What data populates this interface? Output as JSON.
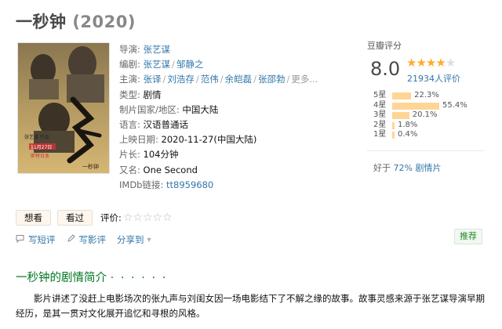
{
  "title": {
    "name": "一秒钟",
    "year": "(2020)"
  },
  "poster": {
    "release_line1": "11月27日",
    "release_line2": "即将日本",
    "calligraphy": "一秒钟",
    "director_caption": "张艺谋 作品"
  },
  "info": {
    "director_label": "导演:",
    "director": "张艺谋",
    "writer_label": "编剧:",
    "writers": [
      "张艺谋",
      "邹静之"
    ],
    "cast_label": "主演:",
    "cast": [
      "张译",
      "刘浩存",
      "范伟",
      "余皑磊",
      "张邵勃"
    ],
    "cast_more": "更多...",
    "genre_label": "类型:",
    "genre": "剧情",
    "region_label": "制片国家/地区:",
    "region": "中国大陆",
    "language_label": "语言:",
    "language": "汉语普通话",
    "release_label": "上映日期:",
    "release": "2020-11-27(中国大陆)",
    "runtime_label": "片长:",
    "runtime": "104分钟",
    "aka_label": "又名:",
    "aka": "One Second",
    "imdb_label": "IMDb链接:",
    "imdb": "tt8959680"
  },
  "rating": {
    "label": "豆瓣评分",
    "score": "8.0",
    "stars_filled": 4,
    "votes": "21934人评价",
    "distribution": [
      {
        "label": "5星",
        "pct": "22.3%",
        "value": 22.3
      },
      {
        "label": "4星",
        "pct": "55.4%",
        "value": 55.4
      },
      {
        "label": "3星",
        "pct": "20.1%",
        "value": 20.1
      },
      {
        "label": "2星",
        "pct": "1.8%",
        "value": 1.8
      },
      {
        "label": "1星",
        "pct": "0.4%",
        "value": 0.4
      }
    ],
    "better_prefix": "好于",
    "better_pct": "72%",
    "better_genre": "剧情片"
  },
  "actions": {
    "want": "想看",
    "seen": "看过",
    "rate_label": "评价:",
    "rate_stars": "☆☆☆☆☆",
    "write_short": "写短评",
    "write_review": "写影评",
    "share": "分享到",
    "share_arrow": "▾",
    "recommend": "推荐"
  },
  "summary": {
    "heading": "一秒钟的剧情简介",
    "heading_dots": "· · · · · ·",
    "text": "影片讲述了没赶上电影场次的张九声与刘闺女因一场电影结下了不解之缘的故事。故事灵感来源于张艺谋导演早期经历，是其一贯对文化展开追忆和寻根的风格。"
  },
  "colors": {
    "link": "#3377aa",
    "star": "#ffac2d",
    "bar": "#ffd596",
    "section": "#007722"
  }
}
